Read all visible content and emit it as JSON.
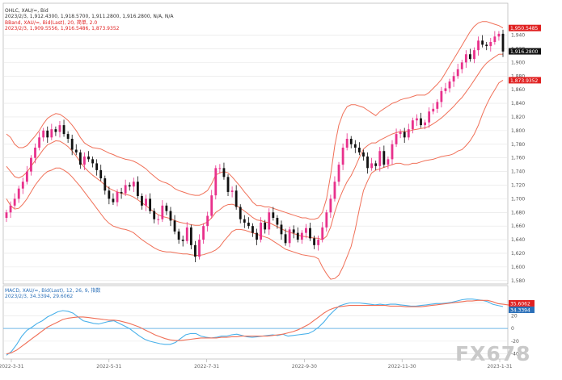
{
  "header": {
    "app_label": "",
    "symbol_line": "OHLC, XAU/=, Bid",
    "price_line": "2023/2/3, 1,912.4300, 1,918.5700, 1,911.2800, 1,916.2800, N/A, N/A",
    "bband_line": "BBand, XAU/=, Bid(Last), 20, 简单, 2.0",
    "bband_values": "2023/2/3, 1,909.5556, 1,916.5486, 1,873.9352",
    "macd_line": "MACD, XAU/=, Bid(Last), 12, 26, 9, 指数",
    "macd_values": "2023/2/3, 34.3394, 29.6062"
  },
  "watermark": "FX678",
  "colors": {
    "up_candle": "#e8318c",
    "down_candle": "#111111",
    "band": "#f07058",
    "macd_line": "#4ab1ea",
    "signal_line": "#f07058",
    "zero_line": "#6fb8e8",
    "grid": "#e4e4e4",
    "label_red": "#e02020",
    "label_black": "#111111",
    "label_blue": "#2a6fb8"
  },
  "price_axis": {
    "ticks": [
      "1,940",
      "1,920",
      "1,900",
      "1,880",
      "1,860",
      "1,840",
      "1,820",
      "1,800",
      "1,780",
      "1,760",
      "1,740",
      "1,720",
      "1,700",
      "1,680",
      "1,660",
      "1,640",
      "1,620",
      "1,600",
      "1,580"
    ],
    "markers": [
      {
        "label": "1,950.5485",
        "value": 1950.5,
        "color": "#e02020"
      },
      {
        "label": "1,916.2800",
        "value": 1916.3,
        "color": "#111111"
      },
      {
        "label": "1,873.9352",
        "value": 1873.9,
        "color": "#e02020"
      }
    ]
  },
  "macd_axis": {
    "ticks": [
      "40",
      "20",
      "0",
      "-20",
      "-40"
    ],
    "markers": [
      {
        "label": "35.6062",
        "value": 35.6,
        "color": "#e02020"
      },
      {
        "label": "34.3394",
        "value": 34.3,
        "color": "#2a6fb8"
      }
    ]
  },
  "x_axis": {
    "labels": [
      "2022-3-31",
      "2022-5-31",
      "2022-7-31",
      "2022-9-30",
      "2022-11-30",
      "2023-1-31"
    ]
  },
  "chart_data": [
    {
      "type": "candlestick",
      "title": "OHLC, XAU/=, Bid",
      "ylim": [
        1575,
        1975
      ],
      "x_range": [
        0,
        122
      ],
      "grid": true,
      "close": [
        1680,
        1690,
        1700,
        1715,
        1725,
        1740,
        1760,
        1775,
        1790,
        1800,
        1790,
        1802,
        1798,
        1808,
        1795,
        1788,
        1772,
        1768,
        1750,
        1762,
        1758,
        1752,
        1742,
        1730,
        1712,
        1700,
        1695,
        1710,
        1708,
        1720,
        1718,
        1725,
        1704,
        1690,
        1700,
        1682,
        1670,
        1670,
        1690,
        1682,
        1668,
        1652,
        1640,
        1638,
        1658,
        1632,
        1615,
        1640,
        1660,
        1675,
        1705,
        1745,
        1745,
        1732,
        1710,
        1712,
        1688,
        1670,
        1665,
        1660,
        1650,
        1640,
        1665,
        1655,
        1680,
        1672,
        1662,
        1648,
        1635,
        1655,
        1650,
        1640,
        1650,
        1657,
        1642,
        1632,
        1640,
        1658,
        1680,
        1700,
        1725,
        1750,
        1775,
        1788,
        1780,
        1775,
        1768,
        1762,
        1745,
        1752,
        1748,
        1770,
        1750,
        1758,
        1780,
        1795,
        1798,
        1790,
        1802,
        1815,
        1818,
        1808,
        1812,
        1828,
        1832,
        1842,
        1858,
        1862,
        1872,
        1880,
        1890,
        1900,
        1912,
        1905,
        1918,
        1932,
        1926,
        1924,
        1930,
        1938,
        1942,
        1916
      ],
      "bb_upper": [
        1795,
        1790,
        1780,
        1775,
        1775,
        1778,
        1785,
        1792,
        1800,
        1810,
        1818,
        1822,
        1825,
        1824,
        1820,
        1815,
        1808,
        1800,
        1790,
        1782,
        1778,
        1775,
        1774,
        1773,
        1770,
        1767,
        1765,
        1762,
        1760,
        1758,
        1757,
        1755,
        1752,
        1748,
        1744,
        1738,
        1733,
        1728,
        1725,
        1723,
        1720,
        1715,
        1712,
        1710,
        1708,
        1706,
        1705,
        1705,
        1708,
        1712,
        1722,
        1735,
        1738,
        1740,
        1738,
        1732,
        1725,
        1718,
        1710,
        1703,
        1695,
        1690,
        1690,
        1688,
        1688,
        1686,
        1684,
        1682,
        1680,
        1678,
        1676,
        1674,
        1672,
        1672,
        1670,
        1670,
        1672,
        1680,
        1700,
        1735,
        1778,
        1808,
        1825,
        1835,
        1838,
        1838,
        1836,
        1834,
        1830,
        1826,
        1822,
        1828,
        1832,
        1836,
        1840,
        1842,
        1845,
        1847,
        1848,
        1850,
        1852,
        1852,
        1852,
        1856,
        1862,
        1868,
        1875,
        1885,
        1895,
        1905,
        1915,
        1925,
        1935,
        1945,
        1953,
        1958,
        1960,
        1960,
        1958,
        1956,
        1954,
        1950.5
      ],
      "bb_lower": [
        1700,
        1690,
        1685,
        1686,
        1692,
        1700,
        1710,
        1720,
        1728,
        1735,
        1740,
        1742,
        1745,
        1745,
        1742,
        1738,
        1732,
        1725,
        1718,
        1710,
        1702,
        1694,
        1686,
        1678,
        1670,
        1664,
        1660,
        1658,
        1656,
        1655,
        1653,
        1650,
        1645,
        1640,
        1636,
        1632,
        1628,
        1625,
        1623,
        1622,
        1622,
        1621,
        1620,
        1619,
        1619,
        1618,
        1617,
        1617,
        1618,
        1620,
        1622,
        1625,
        1630,
        1638,
        1645,
        1652,
        1655,
        1655,
        1654,
        1652,
        1650,
        1648,
        1646,
        1644,
        1642,
        1638,
        1634,
        1630,
        1626,
        1624,
        1622,
        1620,
        1618,
        1617,
        1616,
        1615,
        1612,
        1600,
        1590,
        1582,
        1583,
        1588,
        1600,
        1615,
        1630,
        1655,
        1685,
        1712,
        1726,
        1738,
        1742,
        1744,
        1746,
        1748,
        1750,
        1752,
        1752,
        1750,
        1750,
        1752,
        1752,
        1754,
        1756,
        1757,
        1758,
        1760,
        1762,
        1763,
        1764,
        1766,
        1770,
        1772,
        1778,
        1785,
        1795,
        1808,
        1824,
        1838,
        1850,
        1860,
        1870,
        1873.9
      ],
      "bb_middle_color": "#f07058"
    },
    {
      "type": "line",
      "title": "MACD, XAU/=, Bid(Last), 12, 26, 9, 指数",
      "ylim": [
        -48,
        52
      ],
      "series": [
        {
          "name": "MACD",
          "color": "#4ab1ea",
          "values": [
            -42,
            -36,
            -25,
            -12,
            -3,
            2,
            8,
            12,
            18,
            22,
            26,
            28,
            27,
            24,
            18,
            12,
            10,
            8,
            7,
            9,
            11,
            12,
            8,
            4,
            0,
            -6,
            -12,
            -17,
            -20,
            -22,
            -24,
            -25,
            -25,
            -22,
            -16,
            -10,
            -8,
            -8,
            -12,
            -14,
            -15,
            -14,
            -12,
            -12,
            -10,
            -9,
            -11,
            -13,
            -14,
            -13,
            -12,
            -11,
            -10,
            -11,
            -9,
            -12,
            -11,
            -10,
            -9,
            -8,
            -4,
            2,
            10,
            20,
            28,
            35,
            38,
            40,
            40,
            40,
            39,
            38,
            37,
            38,
            37,
            38,
            38,
            37,
            36,
            35,
            35,
            36,
            37,
            38,
            39,
            39,
            40,
            41,
            43,
            45,
            46,
            46,
            45,
            44,
            42,
            38,
            36,
            34.3
          ]
        },
        {
          "name": "Signal",
          "color": "#f07058",
          "values": [
            -40,
            -38,
            -34,
            -28,
            -22,
            -16,
            -10,
            -4,
            2,
            6,
            10,
            14,
            16,
            17,
            18,
            18,
            17,
            16,
            15,
            14,
            13,
            13,
            12,
            10,
            8,
            5,
            2,
            -2,
            -6,
            -10,
            -13,
            -16,
            -18,
            -19,
            -19,
            -18,
            -17,
            -16,
            -15,
            -15,
            -15,
            -15,
            -14,
            -14,
            -13,
            -13,
            -12,
            -12,
            -12,
            -12,
            -12,
            -12,
            -11,
            -10,
            -9,
            -7,
            -5,
            -2,
            2,
            6,
            12,
            18,
            24,
            29,
            32,
            34,
            35,
            36,
            36,
            36,
            36,
            36,
            36,
            36,
            36,
            35,
            35,
            35,
            34,
            34,
            34,
            34,
            35,
            36,
            37,
            38,
            39,
            40,
            41,
            42,
            43,
            43,
            44,
            44,
            44,
            42,
            39,
            38,
            37,
            36,
            36,
            35.6
          ]
        }
      ]
    }
  ]
}
